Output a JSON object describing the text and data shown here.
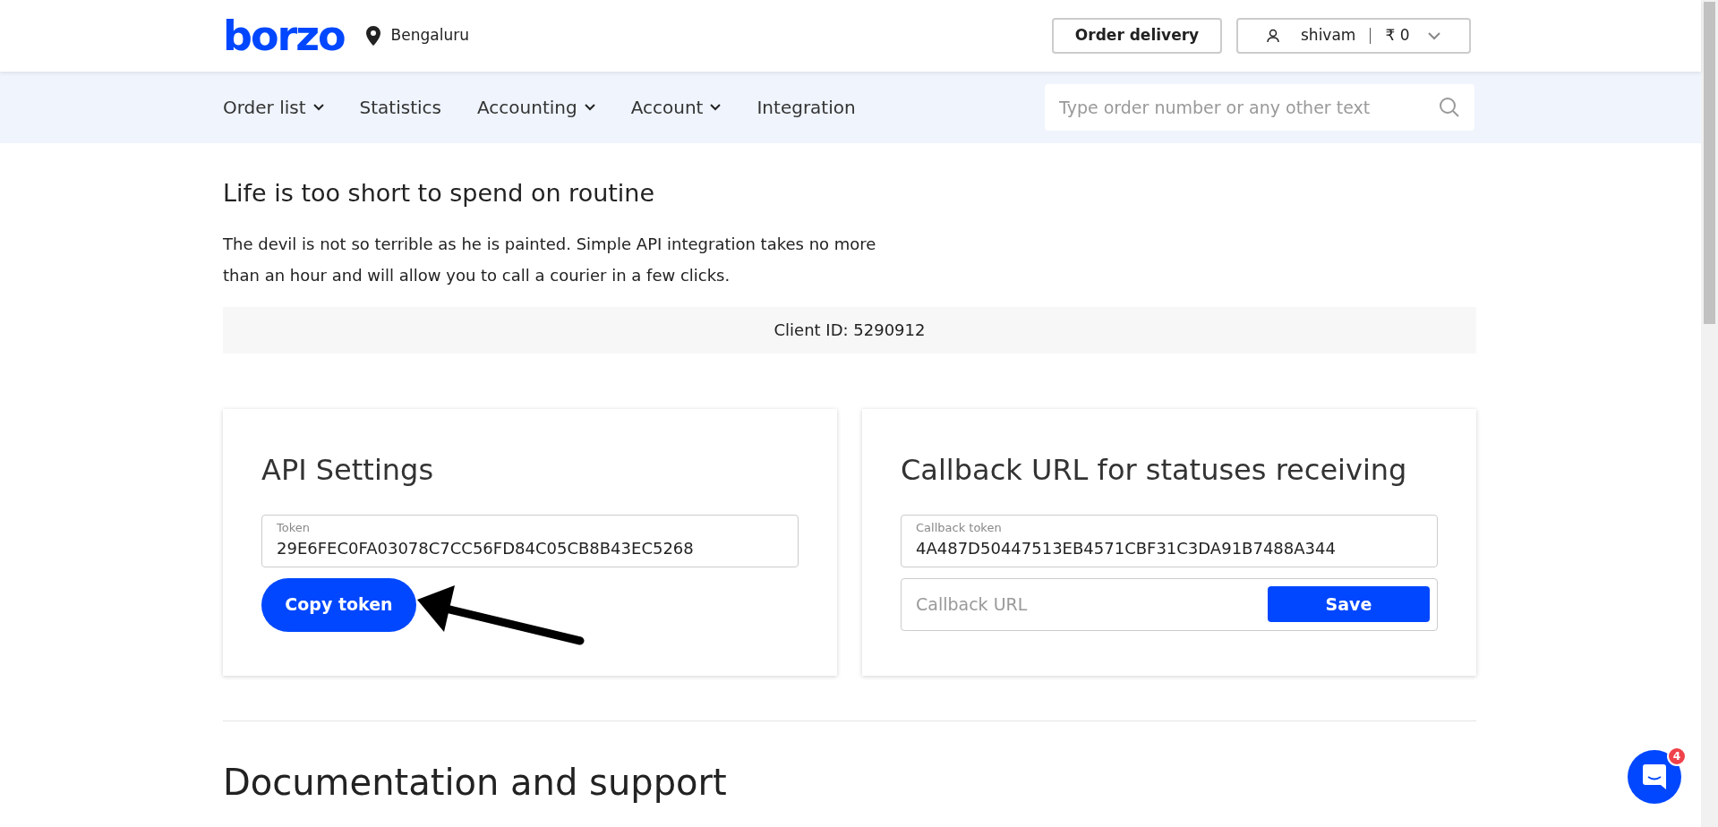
{
  "header": {
    "logo": "borzo",
    "city": "Bengaluru",
    "order_button": "Order delivery",
    "user": {
      "name": "shivam",
      "balance": "₹ 0"
    }
  },
  "nav": {
    "items": [
      {
        "label": "Order list",
        "dropdown": true
      },
      {
        "label": "Statistics",
        "dropdown": false
      },
      {
        "label": "Accounting",
        "dropdown": true
      },
      {
        "label": "Account",
        "dropdown": true
      },
      {
        "label": "Integration",
        "dropdown": false
      }
    ],
    "search_placeholder": "Type order number or any other text"
  },
  "intro": {
    "title": "Life is too short to spend on routine",
    "text": "The devil is not so terrible as he is painted. Simple API integration takes no more than an hour and will allow you to call a courier in a few clicks.",
    "client_id": "Client ID: 5290912"
  },
  "api_settings": {
    "title": "API Settings",
    "token_label": "Token",
    "token": "29E6FEC0FA03078C7CC56FD84C05CB8B43EC5268",
    "copy_button": "Copy token"
  },
  "callback": {
    "title": "Callback URL for statuses receiving",
    "token_label": "Callback token",
    "token": "4A487D50447513EB4571CBF31C3DA91B7488A344",
    "url_placeholder": "Callback URL",
    "save_button": "Save"
  },
  "docs": {
    "title": "Documentation and support"
  },
  "chat": {
    "badge": "4"
  }
}
